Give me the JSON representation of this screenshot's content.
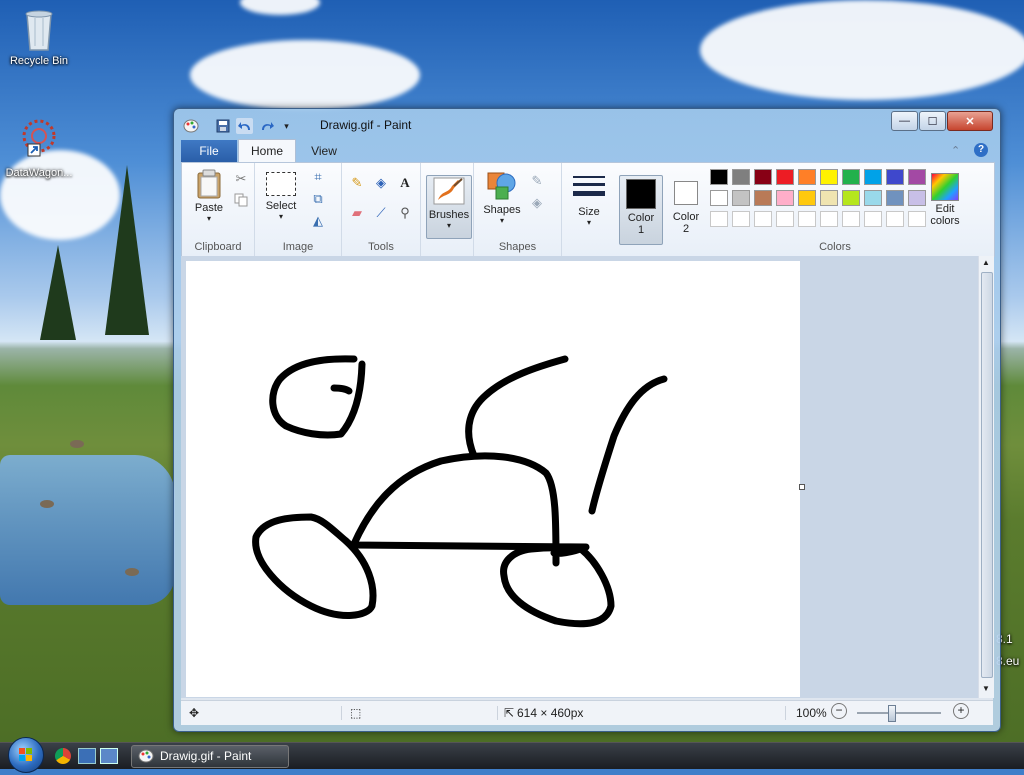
{
  "desktop": {
    "icons": [
      {
        "label": "Recycle Bin",
        "icon": "recycle-bin-icon"
      },
      {
        "label": "DataWagon...",
        "icon": "datawagon-shortcut-icon"
      }
    ],
    "watermark_lines": [
      "8.1",
      "8.eu"
    ]
  },
  "window": {
    "title": "Drawig.gif - Paint",
    "quick_access": [
      "paint-app-icon",
      "save-icon",
      "undo-icon",
      "redo-icon",
      "customize-dropdown-icon"
    ],
    "caption_buttons": {
      "minimize": "—",
      "maximize": "☐",
      "close": "✕"
    }
  },
  "tabs": {
    "file": "File",
    "home": "Home",
    "view": "View"
  },
  "ribbon": {
    "clipboard": {
      "label": "Clipboard",
      "paste": "Paste",
      "cut_icon": "scissors-icon",
      "copy_icon": "copy-icon"
    },
    "image": {
      "label": "Image",
      "select": "Select",
      "crop_icon": "crop-icon",
      "resize_icon": "resize-icon",
      "rotate_icon": "rotate-icon"
    },
    "tools": {
      "label": "Tools",
      "items": [
        "pencil-icon",
        "fill-icon",
        "text-icon",
        "eraser-icon",
        "color-picker-icon",
        "magnifier-icon"
      ]
    },
    "brushes": {
      "label": "Brushes"
    },
    "shapes": {
      "label": "Shapes",
      "button": "Shapes",
      "outline_icon": "outline-icon",
      "fill_icon": "shape-fill-icon"
    },
    "size": {
      "label": "Size"
    },
    "color1": {
      "label": "Color",
      "num": "1",
      "value": "#000000"
    },
    "color2": {
      "label": "Color",
      "num": "2",
      "value": "#ffffff"
    },
    "colors": {
      "label": "Colors",
      "row1": [
        "#000000",
        "#7f7f7f",
        "#880015",
        "#ed1c24",
        "#ff7f27",
        "#fff200",
        "#22b14c",
        "#00a2e8",
        "#3f48cc",
        "#a349a4"
      ],
      "row2": [
        "#ffffff",
        "#c3c3c3",
        "#b97a57",
        "#ffaec9",
        "#ffc90e",
        "#efe4b0",
        "#b5e61d",
        "#99d9ea",
        "#7092be",
        "#c8bfe7"
      ],
      "row3_empty": 10
    },
    "edit_colors": {
      "line1": "Edit",
      "line2": "colors"
    }
  },
  "canvas": {
    "stroke_color": "#000000",
    "background": "#ffffff"
  },
  "status": {
    "dimensions": "614 × 460px",
    "zoom": "100%",
    "zoom_level": 0.4
  },
  "taskbar": {
    "task_label": "Drawig.gif - Paint"
  }
}
